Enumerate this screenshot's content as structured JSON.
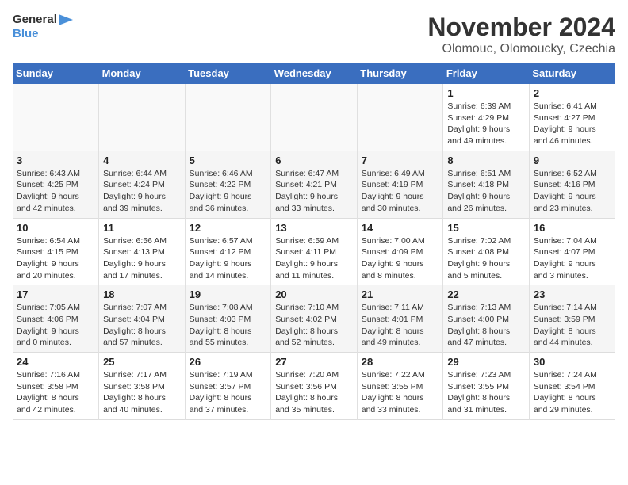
{
  "header": {
    "logo_line1": "General",
    "logo_line2": "Blue",
    "month": "November 2024",
    "location": "Olomouc, Olomoucky, Czechia"
  },
  "days_of_week": [
    "Sunday",
    "Monday",
    "Tuesday",
    "Wednesday",
    "Thursday",
    "Friday",
    "Saturday"
  ],
  "weeks": [
    [
      {
        "day": "",
        "info": ""
      },
      {
        "day": "",
        "info": ""
      },
      {
        "day": "",
        "info": ""
      },
      {
        "day": "",
        "info": ""
      },
      {
        "day": "",
        "info": ""
      },
      {
        "day": "1",
        "info": "Sunrise: 6:39 AM\nSunset: 4:29 PM\nDaylight: 9 hours and 49 minutes."
      },
      {
        "day": "2",
        "info": "Sunrise: 6:41 AM\nSunset: 4:27 PM\nDaylight: 9 hours and 46 minutes."
      }
    ],
    [
      {
        "day": "3",
        "info": "Sunrise: 6:43 AM\nSunset: 4:25 PM\nDaylight: 9 hours and 42 minutes."
      },
      {
        "day": "4",
        "info": "Sunrise: 6:44 AM\nSunset: 4:24 PM\nDaylight: 9 hours and 39 minutes."
      },
      {
        "day": "5",
        "info": "Sunrise: 6:46 AM\nSunset: 4:22 PM\nDaylight: 9 hours and 36 minutes."
      },
      {
        "day": "6",
        "info": "Sunrise: 6:47 AM\nSunset: 4:21 PM\nDaylight: 9 hours and 33 minutes."
      },
      {
        "day": "7",
        "info": "Sunrise: 6:49 AM\nSunset: 4:19 PM\nDaylight: 9 hours and 30 minutes."
      },
      {
        "day": "8",
        "info": "Sunrise: 6:51 AM\nSunset: 4:18 PM\nDaylight: 9 hours and 26 minutes."
      },
      {
        "day": "9",
        "info": "Sunrise: 6:52 AM\nSunset: 4:16 PM\nDaylight: 9 hours and 23 minutes."
      }
    ],
    [
      {
        "day": "10",
        "info": "Sunrise: 6:54 AM\nSunset: 4:15 PM\nDaylight: 9 hours and 20 minutes."
      },
      {
        "day": "11",
        "info": "Sunrise: 6:56 AM\nSunset: 4:13 PM\nDaylight: 9 hours and 17 minutes."
      },
      {
        "day": "12",
        "info": "Sunrise: 6:57 AM\nSunset: 4:12 PM\nDaylight: 9 hours and 14 minutes."
      },
      {
        "day": "13",
        "info": "Sunrise: 6:59 AM\nSunset: 4:11 PM\nDaylight: 9 hours and 11 minutes."
      },
      {
        "day": "14",
        "info": "Sunrise: 7:00 AM\nSunset: 4:09 PM\nDaylight: 9 hours and 8 minutes."
      },
      {
        "day": "15",
        "info": "Sunrise: 7:02 AM\nSunset: 4:08 PM\nDaylight: 9 hours and 5 minutes."
      },
      {
        "day": "16",
        "info": "Sunrise: 7:04 AM\nSunset: 4:07 PM\nDaylight: 9 hours and 3 minutes."
      }
    ],
    [
      {
        "day": "17",
        "info": "Sunrise: 7:05 AM\nSunset: 4:06 PM\nDaylight: 9 hours and 0 minutes."
      },
      {
        "day": "18",
        "info": "Sunrise: 7:07 AM\nSunset: 4:04 PM\nDaylight: 8 hours and 57 minutes."
      },
      {
        "day": "19",
        "info": "Sunrise: 7:08 AM\nSunset: 4:03 PM\nDaylight: 8 hours and 55 minutes."
      },
      {
        "day": "20",
        "info": "Sunrise: 7:10 AM\nSunset: 4:02 PM\nDaylight: 8 hours and 52 minutes."
      },
      {
        "day": "21",
        "info": "Sunrise: 7:11 AM\nSunset: 4:01 PM\nDaylight: 8 hours and 49 minutes."
      },
      {
        "day": "22",
        "info": "Sunrise: 7:13 AM\nSunset: 4:00 PM\nDaylight: 8 hours and 47 minutes."
      },
      {
        "day": "23",
        "info": "Sunrise: 7:14 AM\nSunset: 3:59 PM\nDaylight: 8 hours and 44 minutes."
      }
    ],
    [
      {
        "day": "24",
        "info": "Sunrise: 7:16 AM\nSunset: 3:58 PM\nDaylight: 8 hours and 42 minutes."
      },
      {
        "day": "25",
        "info": "Sunrise: 7:17 AM\nSunset: 3:58 PM\nDaylight: 8 hours and 40 minutes."
      },
      {
        "day": "26",
        "info": "Sunrise: 7:19 AM\nSunset: 3:57 PM\nDaylight: 8 hours and 37 minutes."
      },
      {
        "day": "27",
        "info": "Sunrise: 7:20 AM\nSunset: 3:56 PM\nDaylight: 8 hours and 35 minutes."
      },
      {
        "day": "28",
        "info": "Sunrise: 7:22 AM\nSunset: 3:55 PM\nDaylight: 8 hours and 33 minutes."
      },
      {
        "day": "29",
        "info": "Sunrise: 7:23 AM\nSunset: 3:55 PM\nDaylight: 8 hours and 31 minutes."
      },
      {
        "day": "30",
        "info": "Sunrise: 7:24 AM\nSunset: 3:54 PM\nDaylight: 8 hours and 29 minutes."
      }
    ]
  ]
}
